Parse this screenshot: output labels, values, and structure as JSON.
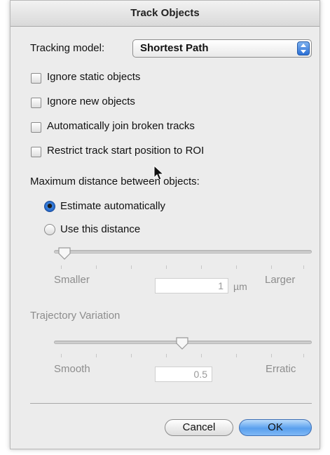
{
  "window": {
    "title": "Track Objects"
  },
  "tracking_model": {
    "label": "Tracking model:",
    "value": "Shortest Path"
  },
  "options": [
    {
      "label": "Ignore static objects",
      "checked": false
    },
    {
      "label": "Ignore new objects",
      "checked": false
    },
    {
      "label": "Automatically join broken tracks",
      "checked": false
    },
    {
      "label": "Restrict track start position to ROI",
      "checked": false
    }
  ],
  "max_distance": {
    "heading": "Maximum distance between objects:",
    "estimate_label": "Estimate automatically",
    "use_label": "Use this distance",
    "selected": "estimate",
    "min_label": "Smaller",
    "max_label": "Larger",
    "value": "1",
    "unit": "µm",
    "slider_fraction": 0.05
  },
  "trajectory": {
    "heading": "Trajectory Variation",
    "min_label": "Smooth",
    "max_label": "Erratic",
    "value": "0.5",
    "slider_fraction": 0.5
  },
  "buttons": {
    "cancel": "Cancel",
    "ok": "OK"
  }
}
